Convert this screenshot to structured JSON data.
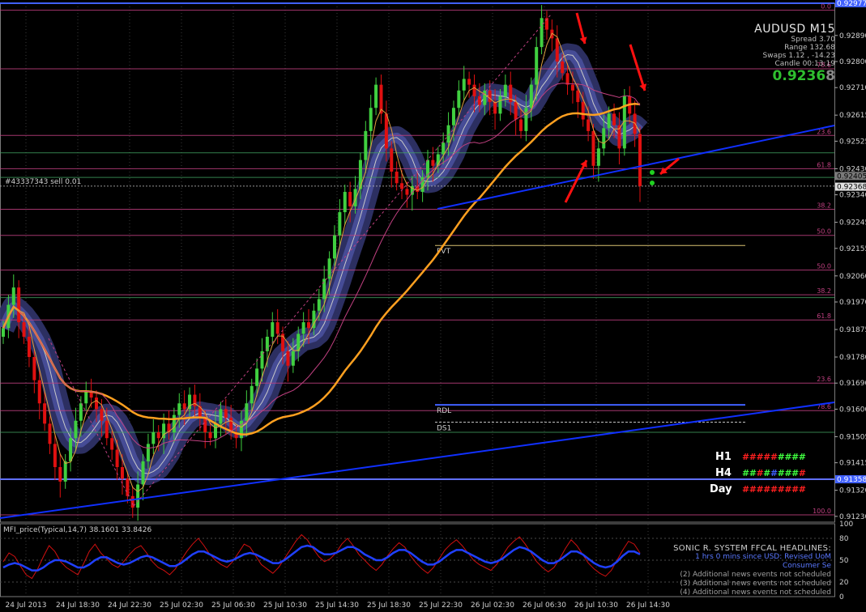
{
  "chart_data": [
    {
      "type": "candlestick",
      "title": "AUDUSD  M15",
      "symbol": "AUDUSD",
      "timeframe": "M15",
      "x_ticks": [
        "24 Jul 2013",
        "24 Jul 18:30",
        "24 Jul 22:30",
        "25 Jul 02:30",
        "25 Jul 06:30",
        "25 Jul 10:30",
        "25 Jul 14:30",
        "25 Jul 18:30",
        "25 Jul 22:30",
        "26 Jul 02:30",
        "26 Jul 06:30",
        "26 Jul 10:30",
        "26 Jul 14:30"
      ],
      "y_ticks": [
        "0.92890",
        "0.92800",
        "0.92710",
        "0.92615",
        "0.92525",
        "0.92430",
        "0.92340",
        "0.92245",
        "0.92155",
        "0.92060",
        "0.91970",
        "0.91875",
        "0.91780",
        "0.91690",
        "0.91600",
        "0.91505",
        "0.91415",
        "0.91320",
        "0.91230"
      ],
      "ylim": [
        0.9121,
        0.9299
      ],
      "price_tags": {
        "top": "0.92977",
        "current": "0.92368",
        "line2": "0.92405",
        "lower": "0.91358"
      },
      "closes": [
        0.9188,
        0.9196,
        0.9202,
        0.919,
        0.9185,
        0.9178,
        0.917,
        0.9162,
        0.9155,
        0.9148,
        0.914,
        0.9135,
        0.9142,
        0.915,
        0.9156,
        0.9162,
        0.9166,
        0.9164,
        0.916,
        0.9156,
        0.915,
        0.9146,
        0.914,
        0.9136,
        0.913,
        0.9126,
        0.9134,
        0.9142,
        0.9148,
        0.9152,
        0.915,
        0.9155,
        0.9152,
        0.9158,
        0.9162,
        0.916,
        0.9165,
        0.9161,
        0.9157,
        0.9152,
        0.915,
        0.9155,
        0.916,
        0.9157,
        0.9152,
        0.915,
        0.9156,
        0.9162,
        0.9168,
        0.9174,
        0.918,
        0.9185,
        0.919,
        0.9186,
        0.918,
        0.9175,
        0.918,
        0.9186,
        0.919,
        0.9188,
        0.9194,
        0.9198,
        0.9205,
        0.9212,
        0.922,
        0.9228,
        0.9235,
        0.923,
        0.9236,
        0.9246,
        0.9256,
        0.9264,
        0.9272,
        0.9262,
        0.925,
        0.9242,
        0.9238,
        0.9236,
        0.9234,
        0.9237,
        0.9235,
        0.924,
        0.9246,
        0.9244,
        0.9248,
        0.9252,
        0.9258,
        0.9264,
        0.927,
        0.9274,
        0.9272,
        0.9268,
        0.9265,
        0.927,
        0.9266,
        0.9262,
        0.9268,
        0.9272,
        0.9266,
        0.926,
        0.9256,
        0.9264,
        0.9272,
        0.9285,
        0.9295,
        0.9291,
        0.9288,
        0.928,
        0.9276,
        0.9272,
        0.927,
        0.9266,
        0.926,
        0.9256,
        0.9244,
        0.925,
        0.9257,
        0.9262,
        0.9258,
        0.925,
        0.9268,
        0.9262,
        0.9255,
        0.9237
      ],
      "series": [
        {
          "name": "",
          "kind": "moving-average",
          "color": "#ffa020"
        },
        {
          "name": "",
          "kind": "channel-band",
          "color": "#3a3f7a"
        },
        {
          "name": "",
          "kind": "wma",
          "color": "#ff80c0"
        }
      ],
      "levels": [
        {
          "label": "0.0",
          "price": 0.92977,
          "color": "#c04080",
          "tag": "fib"
        },
        {
          "label": "78.6",
          "price": 0.92775,
          "color": "#c04080",
          "tag": "fib"
        },
        {
          "label": "23.6",
          "price": 0.92545,
          "color": "#c04080",
          "tag": "fib"
        },
        {
          "label": "61.8",
          "price": 0.9243,
          "color": "#c04080",
          "tag": "fib"
        },
        {
          "label": "38.2",
          "price": 0.9229,
          "color": "#c04080",
          "tag": "fib"
        },
        {
          "label": "50.0",
          "price": 0.922,
          "color": "#c04080",
          "tag": "fib"
        },
        {
          "label": "50.0",
          "price": 0.9208,
          "color": "#c04080",
          "tag": "fib"
        },
        {
          "label": "38.2",
          "price": 0.91995,
          "color": "#c04080",
          "tag": "fib"
        },
        {
          "label": "61.8",
          "price": 0.91908,
          "color": "#c04080",
          "tag": "fib"
        },
        {
          "label": "23.6",
          "price": 0.9169,
          "color": "#c04080",
          "tag": "fib"
        },
        {
          "label": "78.6",
          "price": 0.91595,
          "color": "#c04080",
          "tag": "fib"
        },
        {
          "label": "100.0",
          "price": 0.91235,
          "color": "#c04080",
          "tag": "fib"
        }
      ],
      "pivots": [
        {
          "label": "PVT",
          "price": 0.92165,
          "color": "#d8c070"
        },
        {
          "label": "RDL",
          "price": 0.91615,
          "color": "#4060ff"
        },
        {
          "label": "DS1",
          "price": 0.91555,
          "color": "#c0c0c0"
        }
      ],
      "order_label": "#43337343 sell 0.01",
      "info_panel": {
        "symbol_line": "AUDUSD  M15",
        "spread": "Spread   3.70",
        "range": "Range   132.68",
        "swaps": "Swaps   1.12 , -14.23",
        "candle": "Candle   00:13:19",
        "price_main": "0.9236",
        "price_last": "8"
      },
      "tf_panel": [
        {
          "label": "H1",
          "marks": "#########",
          "colors": [
            "#ff2020",
            "#ff2020",
            "#ff2020",
            "#ff2020",
            "#ff2020",
            "#40ff40",
            "#40ff40",
            "#40ff40",
            "#40ff40"
          ]
        },
        {
          "label": "H4",
          "marks": "#########",
          "colors": [
            "#40ff40",
            "#40ff40",
            "#ff2020",
            "#40ff40",
            "#4060ff",
            "#40ff40",
            "#40ff40",
            "#40ff40",
            "#ff2020"
          ]
        },
        {
          "label": "Day",
          "marks": "#########",
          "colors": [
            "#ff2020",
            "#ff2020",
            "#ff2020",
            "#ff2020",
            "#ff2020",
            "#ff2020",
            "#ff2020",
            "#ff2020",
            "#ff2020"
          ]
        }
      ]
    },
    {
      "type": "line",
      "title": "MFI_price(Typical,14,7) 38.1601 33.8426",
      "ylim": [
        0,
        100
      ],
      "y_ticks": [
        "100",
        "80",
        "50",
        "20",
        "0"
      ],
      "series": [
        {
          "name": "",
          "color": "#d01010",
          "values": [
            48,
            60,
            55,
            42,
            30,
            25,
            38,
            55,
            70,
            62,
            48,
            40,
            35,
            30,
            45,
            62,
            72,
            60,
            52,
            44,
            40,
            48,
            58,
            66,
            70,
            60,
            48,
            40,
            36,
            30,
            38,
            50,
            62,
            72,
            80,
            70,
            58,
            50,
            44,
            40,
            48,
            60,
            72,
            68,
            56,
            44,
            38,
            32,
            40,
            52,
            64,
            76,
            85,
            78,
            66,
            55,
            48,
            52,
            60,
            72,
            80,
            70,
            58,
            50,
            42,
            36,
            44,
            56,
            66,
            74,
            68,
            56,
            46,
            38,
            32,
            40,
            52,
            64,
            72,
            78,
            70,
            60,
            50,
            44,
            40,
            36,
            44,
            56,
            68,
            76,
            82,
            72,
            60,
            48,
            40,
            34,
            40,
            52,
            66,
            78,
            70,
            58,
            46,
            38,
            32,
            28,
            36,
            50,
            64,
            76,
            72,
            60
          ]
        },
        {
          "name": "",
          "color": "#2040ff",
          "values": [
            40,
            44,
            46,
            44,
            40,
            36,
            36,
            40,
            46,
            50,
            50,
            48,
            44,
            40,
            40,
            44,
            50,
            54,
            54,
            50,
            46,
            44,
            46,
            50,
            54,
            56,
            54,
            50,
            46,
            42,
            42,
            46,
            52,
            58,
            62,
            62,
            58,
            54,
            50,
            48,
            50,
            54,
            58,
            60,
            58,
            54,
            50,
            46,
            46,
            50,
            56,
            62,
            68,
            70,
            68,
            62,
            58,
            58,
            60,
            64,
            68,
            68,
            64,
            58,
            54,
            50,
            50,
            54,
            60,
            64,
            64,
            60,
            54,
            48,
            44,
            44,
            48,
            54,
            60,
            64,
            64,
            60,
            56,
            52,
            48,
            46,
            48,
            52,
            58,
            64,
            68,
            66,
            62,
            56,
            50,
            46,
            46,
            50,
            56,
            62,
            62,
            58,
            52,
            46,
            42,
            40,
            42,
            48,
            56,
            62,
            62,
            58
          ]
        }
      ]
    }
  ],
  "news_panel": {
    "header": "SONIC R. SYSTEM  FFCAL HEADLINES:",
    "line1": "1 hrs 0 mins since USD: Revised UoM Consumer Se",
    "line2": "(2)  Additional news events not scheduled",
    "line3": "(3)  Additional news events not scheduled",
    "line4": "(4)  Additional news events not scheduled"
  },
  "colors": {
    "background": "#000000",
    "grid": "#3a3a3a",
    "bull_candle": "#40d040",
    "bear_candle": "#e01010",
    "trendline": "#1030ff",
    "annotation_arrow": "#ff1010"
  }
}
